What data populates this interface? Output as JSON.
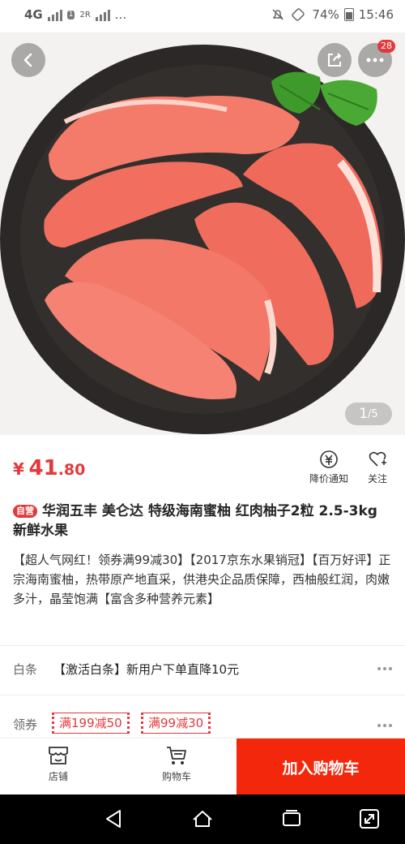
{
  "status": {
    "network": "4G",
    "sim2": "2R",
    "sim_badge": "1",
    "more": "...",
    "battery": "74%",
    "time": "15:46"
  },
  "hero": {
    "image_counter_current": "1",
    "image_counter_total": "/5",
    "notification_count": "28",
    "icons": [
      "back-icon",
      "share-icon",
      "more-icon"
    ]
  },
  "product": {
    "currency": "¥",
    "price_int": "41",
    "price_dec": ".80",
    "price_alert_label": "降价通知",
    "follow_label": "关注",
    "self_tag": "自营",
    "title": "华润五丰 美仑达 特级海南蜜柚 红肉柚子2粒 2.5-3kg 新鲜水果",
    "description": "【超人气网红！领券满99减30】【2017京东水果销冠】【百万好评】正宗海南蜜柚，热带原产地直采，供港央企品质保障，西柚般红润，肉嫩多汁，晶莹饱满【富含多种营养元素】"
  },
  "baitiao": {
    "label": "白条",
    "text": "【激活白条】新用户下单直降10元"
  },
  "coupons": {
    "label": "领券",
    "items": [
      "满199减50",
      "满99减30"
    ]
  },
  "bottom_bar": {
    "shop_label": "店铺",
    "cart_label": "购物车",
    "add_to_cart": "加入购物车"
  },
  "colors": {
    "accent": "#e4393c",
    "cart_button": "#f2270c"
  }
}
